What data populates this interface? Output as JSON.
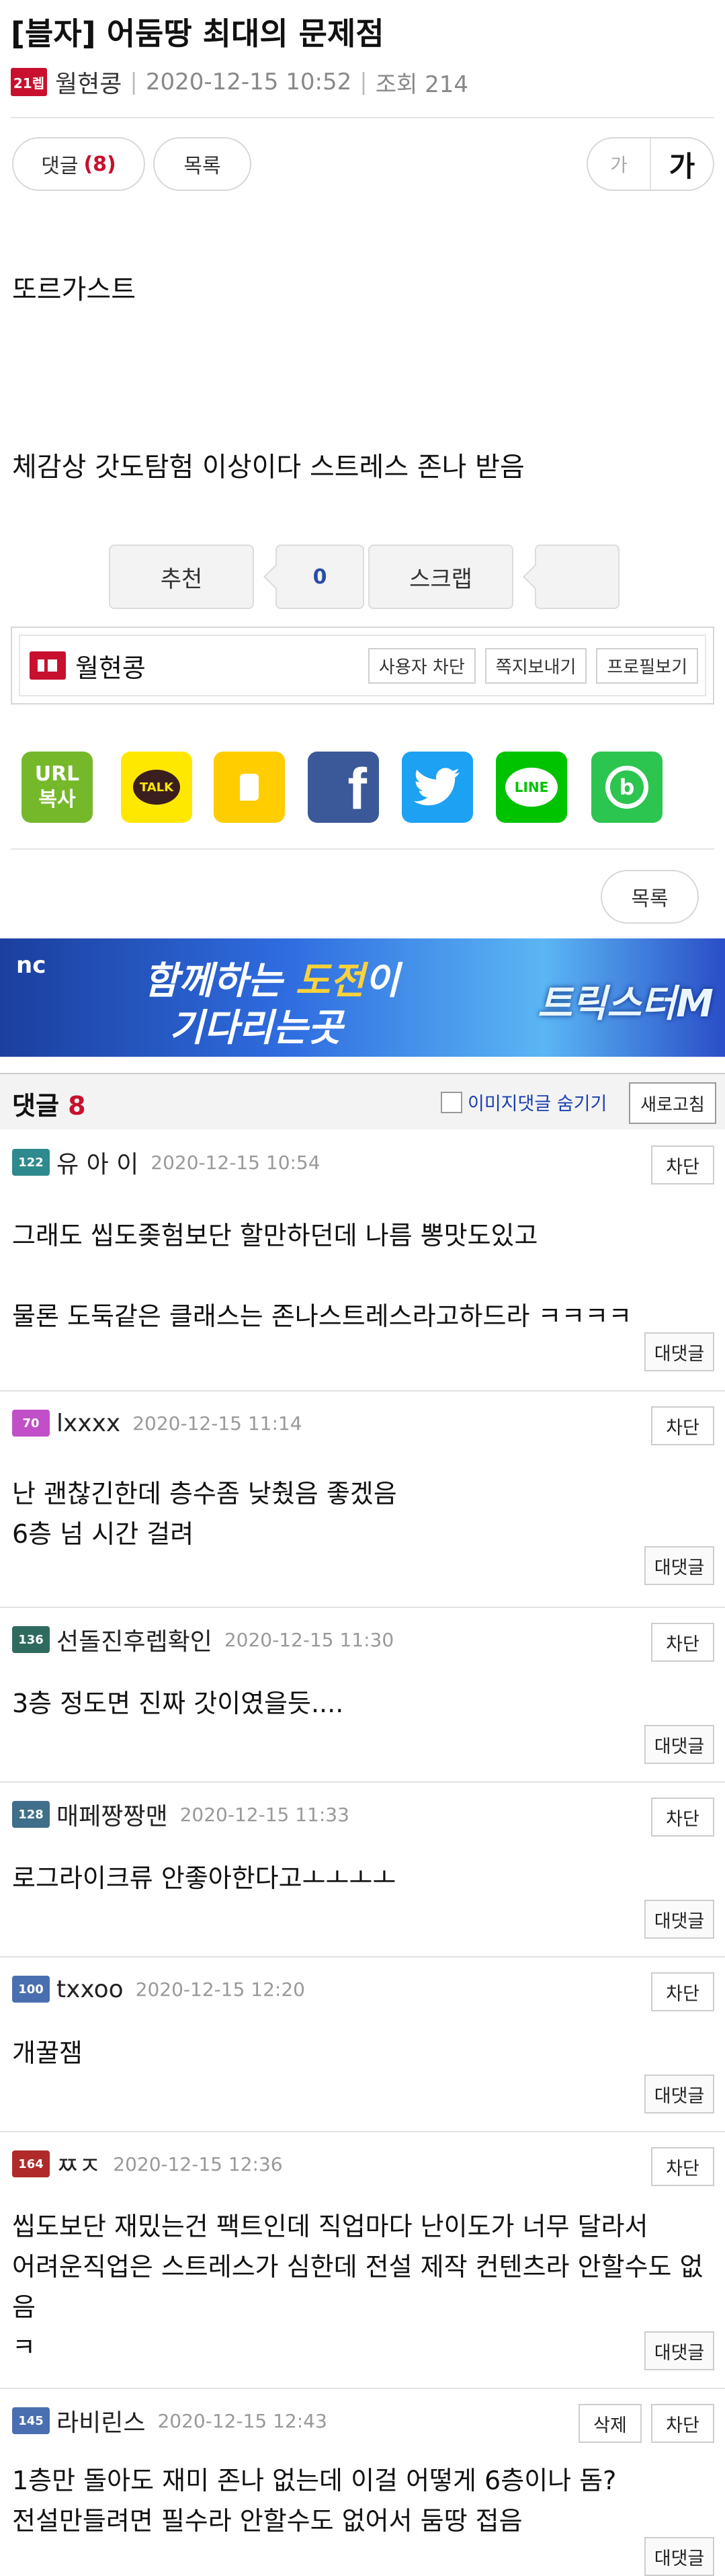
{
  "post": {
    "title": "[블자] 어둠땅 최대의 문제점",
    "author": "월현콩",
    "author_level": "21렙",
    "date": "2020-12-15 10:52",
    "views_label": "조회 214",
    "body_line1": "또르가스트",
    "body_line2": "체감상 갓도탐험 이상이다 스트레스 존나 받음"
  },
  "toolbar": {
    "comments_label": "댓글",
    "comments_count": "(8)",
    "list_label": "목록",
    "font_small": "가",
    "font_big": "가"
  },
  "vote": {
    "recommend_label": "추천",
    "recommend_count": "0",
    "scrap_label": "스크랩",
    "scrap_count": ""
  },
  "author_box": {
    "nick": "월현콩",
    "block_label": "사용자 차단",
    "message_label": "쪽지보내기",
    "profile_label": "프로필보기"
  },
  "share": {
    "url_line1": "URL",
    "url_line2": "복사",
    "kakao_talk": "TALK",
    "facebook": "f",
    "line": "LINE",
    "band": "b"
  },
  "list_button": "목록",
  "banner": {
    "brand": "nc",
    "line1_pre": "함께하는 ",
    "line1_hl": "도전",
    "line1_post": "이",
    "line2": "기다리는곳",
    "logo": "트릭스터M"
  },
  "comments_header": {
    "label": "댓글",
    "count": "8",
    "hide_images_label": "이미지댓글 숨기기",
    "reload_label": "새로고침"
  },
  "comments": [
    {
      "level": "122",
      "level_color": "#2e8a8e",
      "nick": "유 아 이",
      "date": "2020-12-15 10:54",
      "text": "그래도 씹도좆험보단 할만하던데 나름 뽕맛도있고\n\n물론 도둑같은 클래스는 존나스트레스라고하드라 ㅋㅋㅋㅋ",
      "block": "차단",
      "reply": "대댓글"
    },
    {
      "level": "70",
      "level_color": "#c14fc8",
      "nick": "lxxxx",
      "date": "2020-12-15 11:14",
      "text": "난 괜찮긴한데 층수좀 낮췄음 좋겠음\n6층 넘 시간 걸려",
      "block": "차단",
      "reply": "대댓글"
    },
    {
      "level": "136",
      "level_color": "#2e6b5e",
      "nick": "선돌진후렙확인",
      "date": "2020-12-15 11:30",
      "text": "3층 정도면 진짜 갓이였을듯....",
      "block": "차단",
      "reply": "대댓글"
    },
    {
      "level": "128",
      "level_color": "#3f6f8a",
      "nick": "매페짱짱맨",
      "date": "2020-12-15 11:33",
      "text": "로그라이크류 안좋아한다고ㅗㅗㅗㅗ",
      "block": "차단",
      "reply": "대댓글"
    },
    {
      "level": "100",
      "level_color": "#4a6fb0",
      "nick": "txxoo",
      "date": "2020-12-15 12:20",
      "text": "개꿀잼",
      "block": "차단",
      "reply": "대댓글"
    },
    {
      "level": "164",
      "level_color": "#b02a2a",
      "nick": "ㅉㅈ",
      "date": "2020-12-15 12:36",
      "text": "씹도보단 재밌는건 팩트인데 직업마다 난이도가 너무 달라서\n어려운직업은 스트레스가 심한데 전설 제작 컨텐츠라 안할수도 없음\nㅋ",
      "block": "차단",
      "reply": "대댓글"
    },
    {
      "level": "145",
      "level_color": "#4a6fb0",
      "nick": "라비린스",
      "date": "2020-12-15 12:43",
      "text": "1층만 돌아도 재미 존나 없는데 이걸 어떻게 6층이나 돔?\n전설만들려면 필수라 안할수도 없어서 둠땅 접음",
      "delete": "삭제",
      "block": "차단",
      "reply": "대댓글"
    }
  ]
}
